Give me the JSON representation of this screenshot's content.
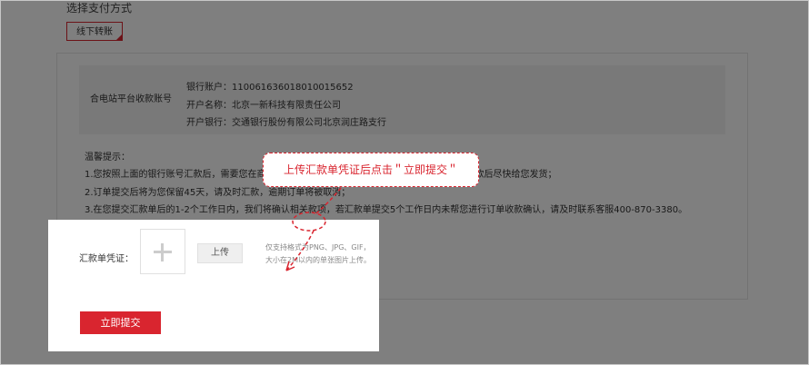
{
  "section_title": "选择支付方式",
  "payment_method": {
    "label": "线下转账"
  },
  "bank": {
    "label": "合电站平台收款账号",
    "account": "银行账户：1100616360180100156​52",
    "name": "开户名称：北京一新科技有限责任公司",
    "branch": "开户银行：交通银行股份有限公司北京润庄路支行"
  },
  "tips": {
    "title": "温馨提示：",
    "line1": "1.您按照上面的银行账号汇款后，需要您在商城订单中上传汇款单凭证，我们将在确认收到您的汇款后尽快给您发货；",
    "line2": "2.订单提交后将为您保留45天，请及时汇款，逾期订单将被取消；",
    "line3": "3.在您提交汇款单后的1-2个工作日内，我们将确认相关款项，若汇款单提交5个工作日内未帮您进行订单收款确认，请及时联系客服400-870-3380。"
  },
  "voucher": {
    "label": "汇款单凭证：",
    "upload_label": "上传",
    "hint1": "仅支持格式为PNG、JPG、GIF，",
    "hint2": "大小在2M以内的单张图片上传。"
  },
  "submit_label": "立即提交",
  "callout_text": "上传汇款单凭证后点击＂立即提交＂",
  "colors": {
    "accent": "#d9252f",
    "overlay": "rgba(0,0,0,0.5)"
  }
}
